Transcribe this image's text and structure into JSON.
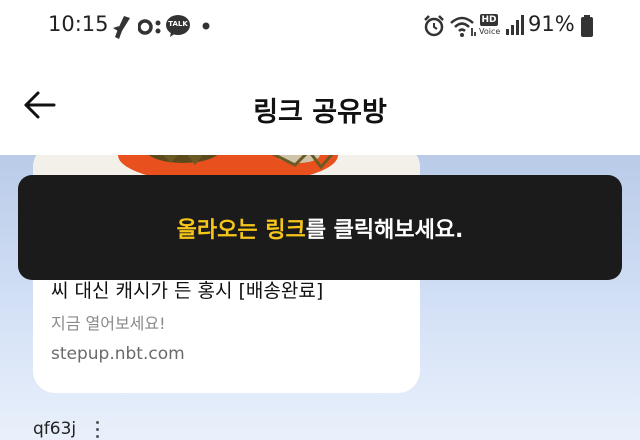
{
  "status_bar": {
    "time": "10:15",
    "battery_percent": "91%",
    "hd_voice_line1": "HD",
    "hd_voice_line2": "Voice",
    "talk_badge": "TALK",
    "icons": [
      "jet-icon",
      "infinity-icon",
      "talk-icon",
      "dot-icon",
      "alarm-icon",
      "wifi-icon",
      "hd-voice-icon",
      "signal-icon",
      "battery-icon"
    ]
  },
  "header": {
    "title": "링크 공유방",
    "back_icon": "back-arrow-icon"
  },
  "link_card": {
    "title": "씨 대신 캐시가 든 홍시 [배송완료]",
    "subtitle": "지금 열어보세요!",
    "domain": "stepup.nbt.com",
    "thumbnail": "persimmon-image"
  },
  "sender": {
    "name": "qf63j",
    "menu_icon": "more-vertical-icon"
  },
  "toast": {
    "highlight": "올라오는 링크",
    "rest": "를 클릭해보세요."
  },
  "colors": {
    "toast_background": "#1b1b1b",
    "toast_highlight": "#f5c51a",
    "chat_background_top": "#b9cbe8",
    "chat_background_bottom": "#e9f0fb"
  }
}
